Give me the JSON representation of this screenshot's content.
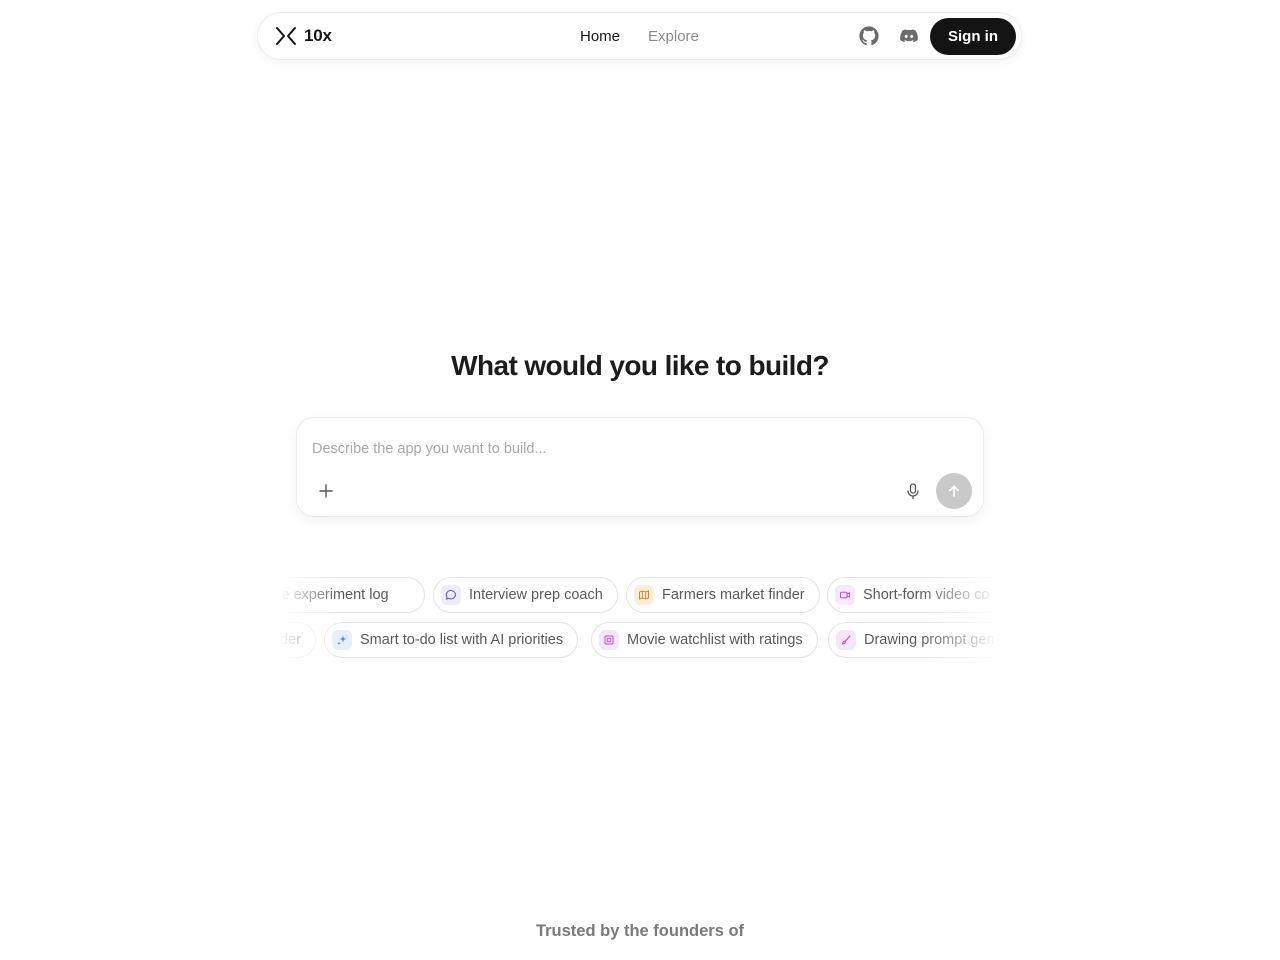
{
  "brand": {
    "name": "10x",
    "logo_icon": "chevrons-logo-icon"
  },
  "nav": {
    "links": [
      {
        "label": "Home",
        "active": true
      },
      {
        "label": "Explore",
        "active": false
      }
    ],
    "github_icon": "github-icon",
    "discord_icon": "discord-icon",
    "signin_label": "Sign in"
  },
  "hero": {
    "headline": "What would you like to build?",
    "prompt": {
      "placeholder": "Describe the app you want to build...",
      "value": "",
      "attach_icon": "plus-icon",
      "mic_icon": "microphone-icon",
      "send_icon": "arrow-up-icon"
    }
  },
  "suggestions": {
    "row1": [
      {
        "label": "ence experiment log",
        "icon": "",
        "color": ""
      },
      {
        "label": "Interview prep coach",
        "icon": "chat-bubble-icon",
        "color": "#6b5bd6",
        "bg": "#eeebfb"
      },
      {
        "label": "Farmers market finder",
        "icon": "map-icon",
        "color": "#d9822b",
        "bg": "#fbeedd"
      },
      {
        "label": "Short-form video co",
        "icon": "video-icon",
        "color": "#c04fd6",
        "bg": "#f8e8fb"
      }
    ],
    "row2": [
      {
        "label": "der",
        "icon": "",
        "color": ""
      },
      {
        "label": "Smart to-do list with AI priorities",
        "icon": "sparkles-icon",
        "color": "#3b82f6",
        "bg": "#e5effd"
      },
      {
        "label": "Movie watchlist with ratings",
        "icon": "film-icon",
        "color": "#b14fd6",
        "bg": "#f5e7fb"
      },
      {
        "label": "Drawing prompt gen",
        "icon": "brush-icon",
        "color": "#b14fd6",
        "bg": "#f5e7fb"
      }
    ]
  },
  "footer": {
    "trusted_text": "Trusted by the founders of"
  }
}
